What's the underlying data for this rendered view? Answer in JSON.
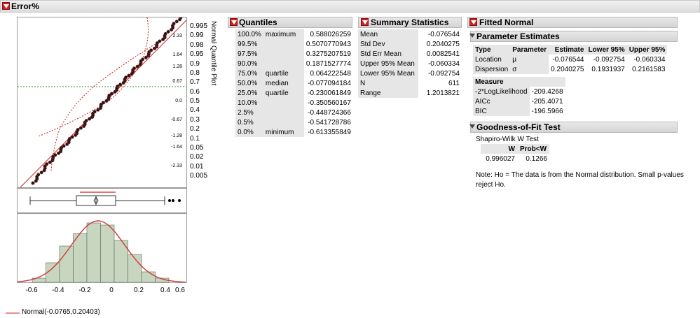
{
  "header": {
    "title": "Error%"
  },
  "quantile_plot": {
    "axis_title": "Normal Quantile Plot",
    "right_ticks": [
      "0.995",
      "0.99",
      "0.98",
      "0.95",
      "0.9",
      "0.8",
      "0.7",
      "0.6",
      "0.5",
      "0.4",
      "0.3",
      "0.2",
      "0.1",
      "0.05",
      "0.02",
      "0.01",
      "0.005"
    ],
    "left_ticks": [
      "2.33",
      "1.64",
      "1.28",
      "0.67",
      "0.0",
      "-0.67",
      "-1.28",
      "-1.64",
      "-2.33"
    ]
  },
  "histogram": {
    "x_ticks": [
      "-0.6",
      "-0.4",
      "-0.2",
      "0",
      "0.2",
      "0.4",
      "0.6"
    ],
    "legend": "Normal(-0.0765,0.20403)"
  },
  "quantiles": {
    "title": "Quantiles",
    "rows": [
      {
        "pct": "100.0%",
        "label": "maximum",
        "value": "0.588026259"
      },
      {
        "pct": "99.5%",
        "label": "",
        "value": "0.5070770943"
      },
      {
        "pct": "97.5%",
        "label": "",
        "value": "0.3275207519"
      },
      {
        "pct": "90.0%",
        "label": "",
        "value": "0.1871527774"
      },
      {
        "pct": "75.0%",
        "label": "quartile",
        "value": "0.064222548"
      },
      {
        "pct": "50.0%",
        "label": "median",
        "value": "-0.077094184"
      },
      {
        "pct": "25.0%",
        "label": "quartile",
        "value": "-0.230061849"
      },
      {
        "pct": "10.0%",
        "label": "",
        "value": "-0.350560167"
      },
      {
        "pct": "2.5%",
        "label": "",
        "value": "-0.448724366"
      },
      {
        "pct": "0.5%",
        "label": "",
        "value": "-0.541728786"
      },
      {
        "pct": "0.0%",
        "label": "minimum",
        "value": "-0.613355849"
      }
    ]
  },
  "summary": {
    "title": "Summary Statistics",
    "rows": [
      {
        "label": "Mean",
        "value": "-0.076544"
      },
      {
        "label": "Std Dev",
        "value": "0.2040275"
      },
      {
        "label": "Std Err Mean",
        "value": "0.0082541"
      },
      {
        "label": "Upper 95% Mean",
        "value": "-0.060334"
      },
      {
        "label": "Lower 95% Mean",
        "value": "-0.092754"
      },
      {
        "label": "N",
        "value": "611"
      },
      {
        "label": "Range",
        "value": "1.2013821"
      }
    ]
  },
  "fitted": {
    "title": "Fitted Normal",
    "param_title": "Parameter Estimates",
    "param_headers": [
      "Type",
      "Parameter",
      "Estimate",
      "Lower 95%",
      "Upper 95%"
    ],
    "param_rows": [
      [
        "Location",
        "μ",
        "-0.076544",
        "-0.092754",
        "-0.060334"
      ],
      [
        "Dispersion",
        "σ",
        "0.2040275",
        "0.1931937",
        "0.2161583"
      ]
    ],
    "measure_header": "Measure",
    "measure_rows": [
      [
        "-2*LogLikelihood",
        "-209.4268"
      ],
      [
        "AICc",
        "-205.4071"
      ],
      [
        "BIC",
        "-196.5966"
      ]
    ],
    "gof_title": "Goodness-of-Fit Test",
    "gof_test": "Shapiro-Wilk W Test",
    "gof_headers": [
      "W",
      "Prob<W"
    ],
    "gof_values": [
      "0.996027",
      "0.1266"
    ],
    "note": "Note: Ho = The data is from the Normal distribution. Small p-values reject Ho."
  },
  "colors": {
    "accent_red": "#d02020",
    "bar_fill": "#c8d6c0",
    "bar_stroke": "#556b55",
    "mean_line": "#2a9a2a"
  }
}
